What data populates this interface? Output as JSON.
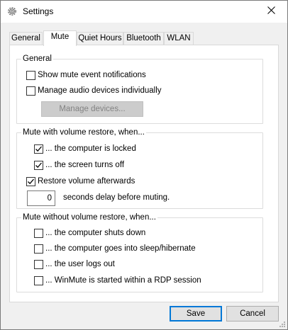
{
  "window": {
    "title": "Settings",
    "close_icon": "close-icon",
    "title_icon": "gear-icon"
  },
  "tabs": [
    {
      "label": "General",
      "active": false
    },
    {
      "label": "Mute",
      "active": true
    },
    {
      "label": "Quiet Hours",
      "active": false
    },
    {
      "label": "Bluetooth",
      "active": false
    },
    {
      "label": "WLAN",
      "active": false
    }
  ],
  "general_group": {
    "label": "General",
    "show_notifications": {
      "label": "Show mute event notifications",
      "checked": false
    },
    "manage_individually": {
      "label": "Manage audio devices individually",
      "checked": false
    },
    "manage_devices_button": "Manage devices..."
  },
  "restore_group": {
    "label": "Mute with volume restore, when...",
    "computer_locked": {
      "label": "... the computer is locked",
      "checked": true
    },
    "screen_off": {
      "label": "... the screen turns off",
      "checked": true
    },
    "restore_afterwards": {
      "label": "Restore volume afterwards",
      "checked": true
    },
    "delay_value": "0",
    "delay_label": "seconds delay before muting."
  },
  "no_restore_group": {
    "label": "Mute without volume restore, when...",
    "shuts_down": {
      "label": "... the computer shuts down",
      "checked": false
    },
    "sleep": {
      "label": "... the computer goes into sleep/hibernate",
      "checked": false
    },
    "logs_out": {
      "label": "... the user logs out",
      "checked": false
    },
    "rdp": {
      "label": "... WinMute is started within a RDP session",
      "checked": false
    }
  },
  "buttons": {
    "save": "Save",
    "cancel": "Cancel"
  }
}
